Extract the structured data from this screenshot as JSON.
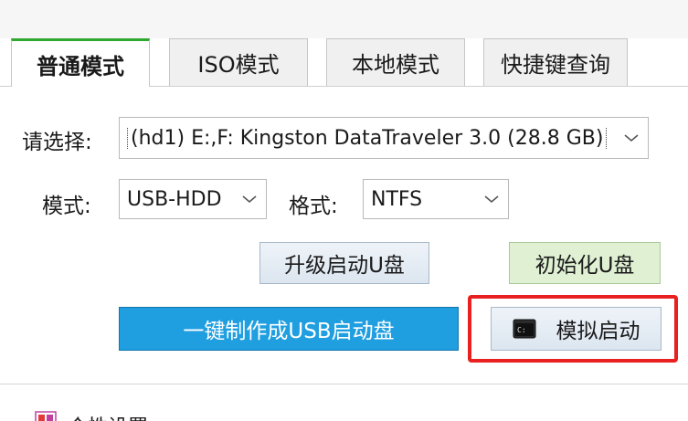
{
  "tabs": [
    {
      "label": "普通模式",
      "active": true
    },
    {
      "label": "ISO模式",
      "active": false
    },
    {
      "label": "本地模式",
      "active": false
    },
    {
      "label": "快捷键查询",
      "active": false
    }
  ],
  "form": {
    "select_label": "请选择:",
    "device_value": "(hd1) E:,F: Kingston DataTraveler 3.0 (28.8 GB)",
    "mode_label": "模式:",
    "mode_value": "USB-HDD",
    "format_label": "格式:",
    "format_value": "NTFS"
  },
  "buttons": {
    "upgrade": "升级启动U盘",
    "initialize": "初始化U盘",
    "create": "一键制作成USB启动盘",
    "simulate": "模拟启动"
  },
  "bottom": {
    "personalize_label": "个性设置"
  },
  "colors": {
    "active_tab_accent": "#2fa82f",
    "primary_button": "#1f9ee0",
    "init_button": "#dff0d3",
    "highlight": "#e8201f"
  },
  "icons": [
    "chevron-down-icon",
    "console-icon",
    "palette-icon"
  ]
}
